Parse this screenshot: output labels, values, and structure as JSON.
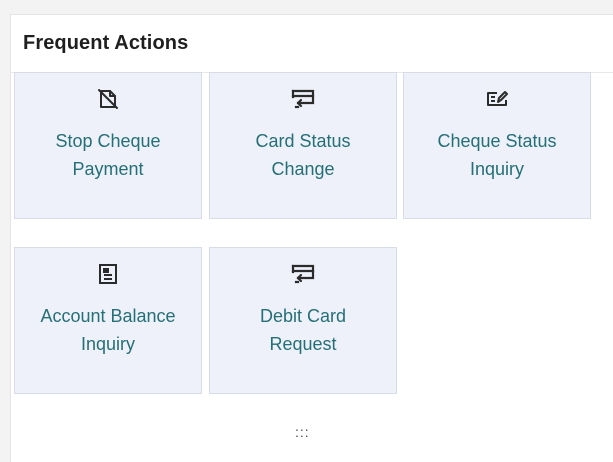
{
  "panel": {
    "title": "Frequent Actions",
    "handle": ":::"
  },
  "actions": [
    {
      "label_line1": "Stop Cheque",
      "label_line2": "Payment",
      "icon": "stop-cheque-icon"
    },
    {
      "label_line1": "Card Status",
      "label_line2": "Change",
      "icon": "card-icon"
    },
    {
      "label_line1": "Cheque Status",
      "label_line2": "Inquiry",
      "icon": "cheque-edit-icon"
    },
    {
      "label_line1": "Account Balance",
      "label_line2": "Inquiry",
      "icon": "account-statement-icon"
    },
    {
      "label_line1": "Debit Card",
      "label_line2": "Request",
      "icon": "card-icon"
    }
  ],
  "colors": {
    "tile_bg": "#eef1f9",
    "label": "#256f76",
    "icon": "#2b2b2b"
  }
}
